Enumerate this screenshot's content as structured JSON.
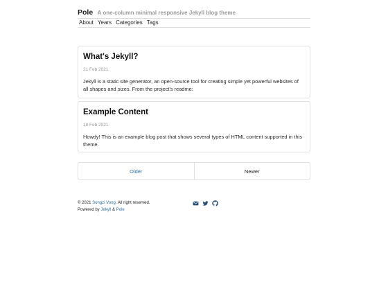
{
  "header": {
    "title": "Pole",
    "description": "A one-column minimal responsive Jekyll blog theme"
  },
  "nav": {
    "items": [
      {
        "label": "About"
      },
      {
        "label": "Years"
      },
      {
        "label": "Categories"
      },
      {
        "label": "Tags"
      }
    ]
  },
  "posts": [
    {
      "title": "What's Jekyll?",
      "date": "21 Feb 2021",
      "excerpt": "Jekyll is a static site generator, an open-source tool for creating simple yet powerful websites of all shapes and sizes. From the project's readme:"
    },
    {
      "title": "Example Content",
      "date": "18 Feb 2021",
      "excerpt": "Howdy! This is an example blog post that shows several types of HTML content supported in this theme."
    }
  ],
  "pagination": {
    "older_label": "Older",
    "newer_label": "Newer"
  },
  "footer": {
    "copyright_prefix": "© 2021",
    "author": "Songzi Vong",
    "copyright_suffix": ". All right reserved.",
    "powered_prefix": "Powered by",
    "powered_link_1": "Jekyll",
    "powered_separator": "&",
    "powered_link_2": "Pole",
    "social_icons": [
      "envelope-icon",
      "twitter-icon",
      "github-icon"
    ]
  },
  "colors": {
    "link": "#2f6fa8",
    "muted": "#9a9a9a",
    "text": "#1f1f1f",
    "border": "#e0e0e0",
    "icon": "#2a4d75"
  }
}
